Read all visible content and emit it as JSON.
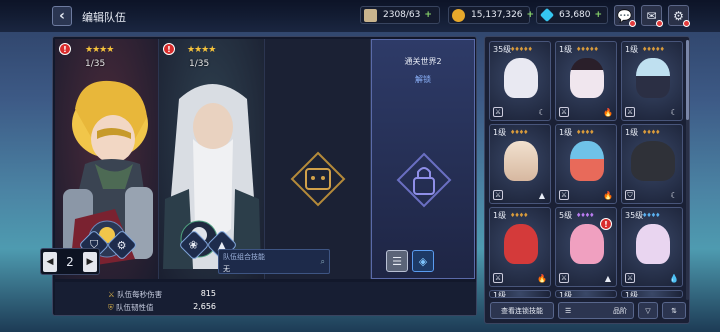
{
  "header": {
    "back_icon": "chevron-left-icon",
    "title": "编辑队伍"
  },
  "resources": {
    "stamina": "2308/63",
    "gold": "15,137,326",
    "gems": "63,680",
    "plus": "+"
  },
  "team_slots": [
    {
      "stars": "★★★★",
      "level": "1/35",
      "skills": [
        "shield",
        "gear"
      ]
    },
    {
      "stars": "★★★★",
      "level": "1/35",
      "skills": [
        "flower",
        "mountain"
      ]
    },
    {
      "state": "empty"
    },
    {
      "locked_title": "通关世界2",
      "unlock_label": "解锁"
    }
  ],
  "bottom_bar": {
    "page": "2",
    "prev": "◀",
    "next": "▶",
    "stat1_label": "队伍每秒伤害",
    "stat1_value": "815",
    "stat2_label": "队伍韧性值",
    "stat2_value": "2,656",
    "combo_title": "队伍组合技能",
    "combo_value": "无"
  },
  "roster": [
    {
      "level": "35级"
    },
    {
      "level": "1级"
    },
    {
      "level": "1级"
    },
    {
      "level": "1级"
    },
    {
      "level": "1级"
    },
    {
      "level": "1级"
    },
    {
      "level": "1级"
    },
    {
      "level": "5级"
    },
    {
      "level": "35级"
    },
    {
      "level": "1级"
    },
    {
      "level": "1级"
    },
    {
      "level": "1级"
    }
  ],
  "roster_buttons": {
    "view_chain": "查看连锁技能",
    "sort": "品阶"
  },
  "colors": {
    "accent": "#4a78c8",
    "alert": "#d82c2c",
    "gold_star": "#f6c33b"
  }
}
